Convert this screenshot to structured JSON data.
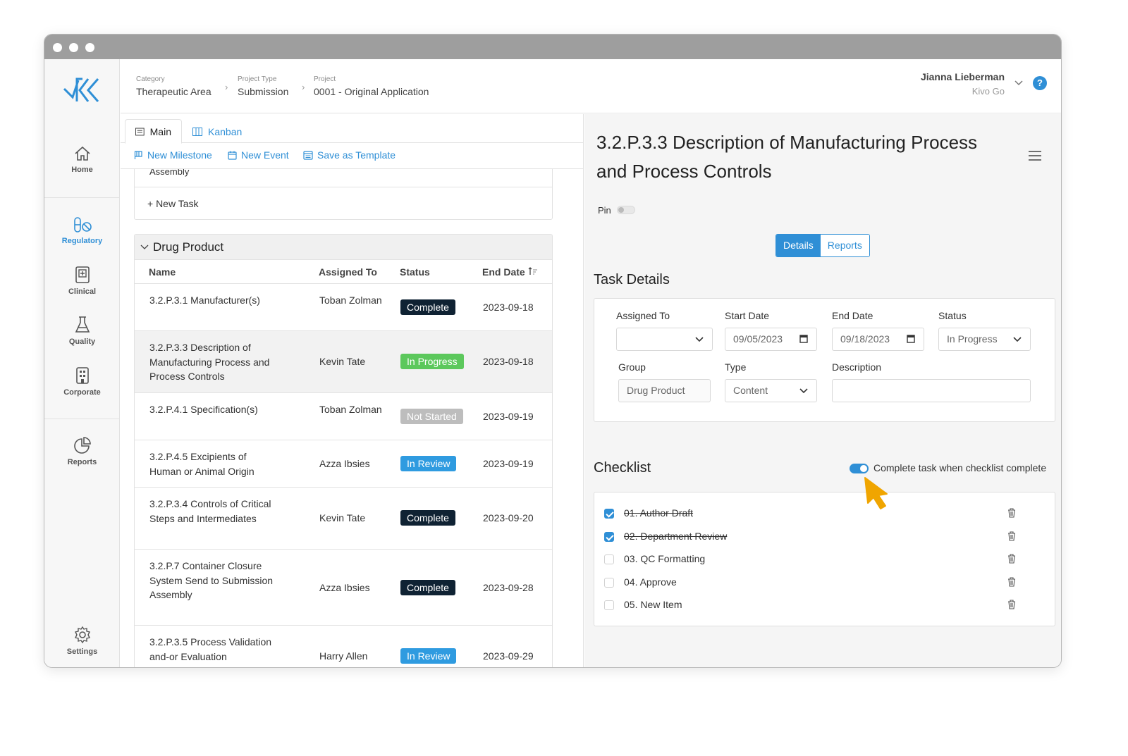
{
  "breadcrumb": [
    {
      "caption": "Category",
      "value": "Therapeutic Area"
    },
    {
      "caption": "Project Type",
      "value": "Submission"
    },
    {
      "caption": "Project",
      "value": "0001 - Original Application"
    }
  ],
  "user": {
    "name": "Jianna Lieberman",
    "org": "Kivo Go",
    "help": "?"
  },
  "sidebar": {
    "items": [
      {
        "label": "Home",
        "icon": "home-icon"
      },
      {
        "label": "Regulatory",
        "icon": "pills-icon",
        "active": true
      },
      {
        "label": "Clinical",
        "icon": "clinical-icon"
      },
      {
        "label": "Quality",
        "icon": "flask-icon"
      },
      {
        "label": "Corporate",
        "icon": "building-icon"
      },
      {
        "label": "Reports",
        "icon": "pie-chart-icon"
      },
      {
        "label": "Settings",
        "icon": "gear-icon"
      }
    ]
  },
  "tabs": [
    {
      "label": "Main",
      "icon": "list-icon",
      "active": true
    },
    {
      "label": "Kanban",
      "icon": "kanban-icon"
    }
  ],
  "actions": [
    {
      "label": "New Milestone",
      "icon": "flag-icon"
    },
    {
      "label": "New Event",
      "icon": "calendar-icon"
    },
    {
      "label": "Save as Template",
      "icon": "template-icon"
    }
  ],
  "previous_group": {
    "tail_text": "Assembly",
    "new_task": "+ New Task"
  },
  "group": {
    "title": "Drug Product",
    "columns": [
      "Name",
      "Assigned To",
      "Status",
      "End Date"
    ],
    "rows": [
      {
        "name": "3.2.P.3.1 Manufacturer(s)",
        "assigned": "Toban Zolman",
        "status": "Complete",
        "end": "2023-09-18"
      },
      {
        "name": "3.2.P.3.3 Description of Manufacturing Process and Process Controls",
        "assigned": "Kevin Tate",
        "status": "In Progress",
        "end": "2023-09-18"
      },
      {
        "name": "3.2.P.4.1 Specification(s)",
        "assigned": "Toban Zolman",
        "status": "Not Started",
        "end": "2023-09-19"
      },
      {
        "name": "3.2.P.4.5 Excipients of Human or Animal Origin",
        "assigned": "Azza Ibsies",
        "status": "In Review",
        "end": "2023-09-19"
      },
      {
        "name": "3.2.P.3.4 Controls of Critical Steps and Intermediates",
        "assigned": "Kevin Tate",
        "status": "Complete",
        "end": "2023-09-20"
      },
      {
        "name": "3.2.P.7 Container Closure System Send to Submission Assembly",
        "assigned": "Azza Ibsies",
        "status": "Complete",
        "end": "2023-09-28"
      },
      {
        "name": "3.2.P.3.5 Process Validation and-or Evaluation",
        "assigned": "Harry Allen",
        "status": "In Review",
        "end": "2023-09-29"
      }
    ]
  },
  "detail": {
    "title": "3.2.P.3.3 Description of Manufacturing Process and Process Controls",
    "pin_label": "Pin",
    "view_tabs": [
      "Details",
      "Reports"
    ],
    "task_details_heading": "Task Details",
    "fields": {
      "assigned_to": {
        "label": "Assigned To",
        "value": ""
      },
      "start_date": {
        "label": "Start Date",
        "value": "09/05/2023"
      },
      "end_date": {
        "label": "End Date",
        "value": "09/18/2023"
      },
      "status": {
        "label": "Status",
        "value": "In Progress"
      },
      "group": {
        "label": "Group",
        "value": "Drug Product"
      },
      "type": {
        "label": "Type",
        "value": "Content"
      },
      "description": {
        "label": "Description",
        "value": ""
      }
    },
    "checklist_heading": "Checklist",
    "checklist_toggle_label": "Complete task when checklist complete",
    "checklist": [
      {
        "label": "01. Author Draft",
        "checked": true
      },
      {
        "label": "02. Department Review",
        "checked": true
      },
      {
        "label": "03. QC Formatting",
        "checked": false
      },
      {
        "label": "04. Approve",
        "checked": false
      },
      {
        "label": "05. New Item",
        "checked": false
      }
    ]
  },
  "colors": {
    "accent": "#2f8fd6",
    "complete": "#0f2233",
    "in_progress": "#5cc85c",
    "not_started": "#bdbdbd",
    "in_review": "#2f9be0",
    "cursor": "#f0a500"
  }
}
